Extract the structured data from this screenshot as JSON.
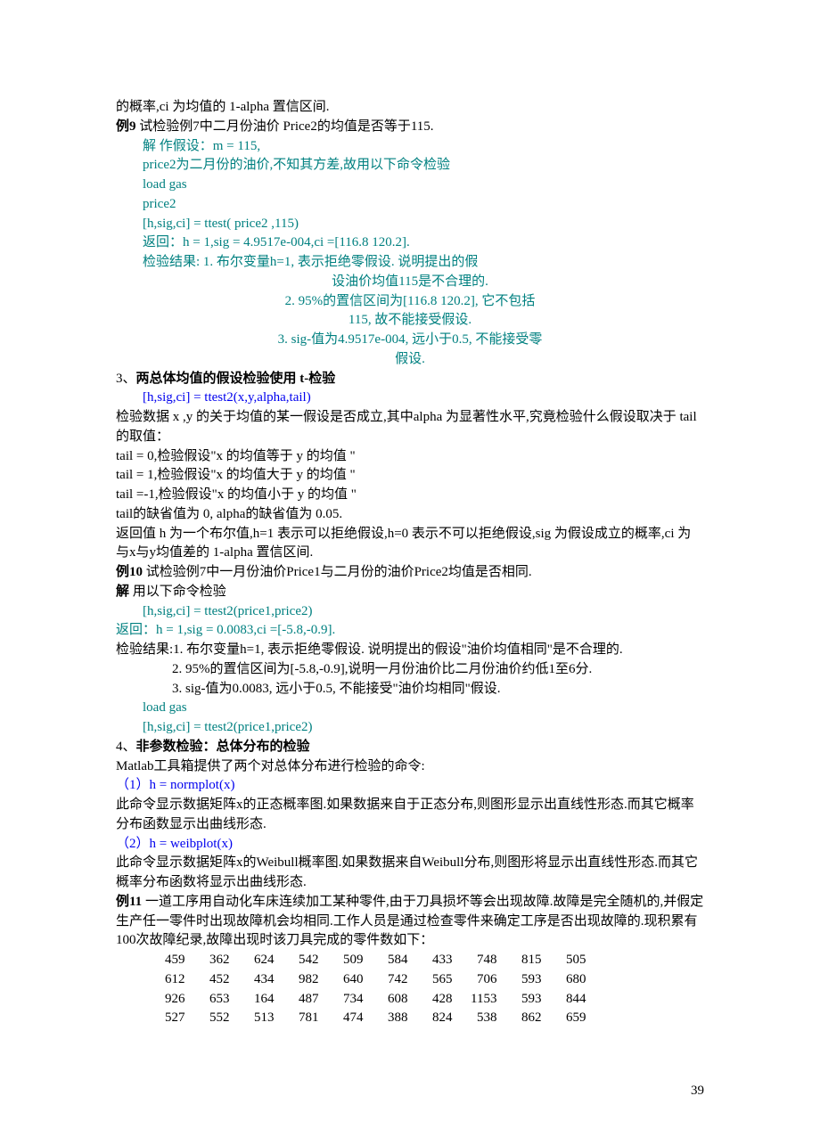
{
  "lines": {
    "l1": "的概率,ci  为均值的  1-alpha  置信区间.",
    "l2a": "例9",
    "l2b": "    试检验例7中二月份油价  Price2的均值是否等于115.",
    "l3": "解    作假设：m = 115,",
    "l4": "price2为二月份的油价,不知其方差,故用以下命令检验",
    "l5": "load gas",
    "l6": "price2",
    "l7": "[h,sig,ci] = ttest( price2 ,115)",
    "l8": "返回：h = 1,sig = 4.9517e-004,ci =[116.8    120.2].",
    "l9": "检验结果: 1.  布尔变量h=1,  表示拒绝零假设.  说明提出的假",
    "l10": "设油价均值115是不合理的.",
    "l11": "2. 95%的置信区间为[116.8    120.2],  它不包括",
    "l12": "115,  故不能接受假设.",
    "l13": "3. sig-值为4.9517e-004,  远小于0.5,  不能接受零",
    "l14": "假设.",
    "s3a": "3、",
    "s3b": "两总体均值的假设检验使用  t-检验",
    "l15": "[h,sig,ci] = ttest2(x,y,alpha,tail)",
    "l16": "检验数据 x ,y 的关于均值的某一假设是否成立,其中alpha  为显著性水平,究竟检验什么假设取决于  tail  的取值：",
    "l17": "tail = 0,检验假设\"x  的均值等于  y  的均值  \"",
    "l18": "tail = 1,检验假设\"x  的均值大于  y  的均值  \"",
    "l19": "tail =-1,检验假设\"x  的均值小于  y  的均值  \"",
    "l20": "tail的缺省值为  0, alpha的缺省值为  0.05.",
    "l21": "       返回值  h  为一个布尔值,h=1  表示可以拒绝假设,h=0  表示不可以拒绝假设,sig  为假设成立的概率,ci  为与x与y均值差的  1-alpha  置信区间.",
    "l22a": "例10",
    "l22b": "    试检验例7中一月份油价Price1与二月份的油价Price2均值是否相同.",
    "l23a": "解",
    "l23b": "    用以下命令检验",
    "l24": "[h,sig,ci] = ttest2(price1,price2)",
    "l25": "返回：h = 1,sig = 0.0083,ci =[-5.8,-0.9].",
    "l26": "检验结果:1.  布尔变量h=1,  表示拒绝零假设.  说明提出的假设\"油价均值相同\"是不合理的.",
    "l27": "2. 95%的置信区间为[-5.8,-0.9],说明一月份油价比二月份油价约低1至6分.",
    "l28": "3. sig-值为0.0083,  远小于0.5,  不能接受\"油价均相同\"假设.",
    "l29": "load gas",
    "l30": "[h,sig,ci] = ttest2(price1,price2)",
    "s4a": "4、",
    "s4b": "非参数检验：总体分布的检验",
    "l31": "Matlab工具箱提供了两个对总体分布进行检验的命令:",
    "l32": "（1）h = normplot(x)",
    "l33": "     此命令显示数据矩阵x的正态概率图.如果数据来自于正态分布,则图形显示出直线性形态.而其它概率分布函数显示出曲线形态.",
    "l34": "（2）h = weibplot(x)",
    "l35": "     此命令显示数据矩阵x的Weibull概率图.如果数据来自Weibull分布,则图形将显示出直线性形态.而其它概率分布函数将显示出曲线形态.",
    "l36a": "例11",
    "l36b": "  一道工序用自动化车床连续加工某种零件,由于刀具损坏等会出现故障.故障是完全随机的,并假定生产任一零件时出现故障机会均相同.工作人员是通过检查零件来确定工序是否出现故障的.现积累有100次故障纪录,故障出现时该刀具完成的零件数如下：",
    "page": "39"
  },
  "table": [
    [
      459,
      362,
      624,
      542,
      509,
      584,
      433,
      748,
      815,
      505
    ],
    [
      612,
      452,
      434,
      982,
      640,
      742,
      565,
      706,
      593,
      680
    ],
    [
      926,
      653,
      164,
      487,
      734,
      608,
      428,
      1153,
      593,
      844
    ],
    [
      527,
      552,
      513,
      781,
      474,
      388,
      824,
      538,
      862,
      659
    ]
  ]
}
